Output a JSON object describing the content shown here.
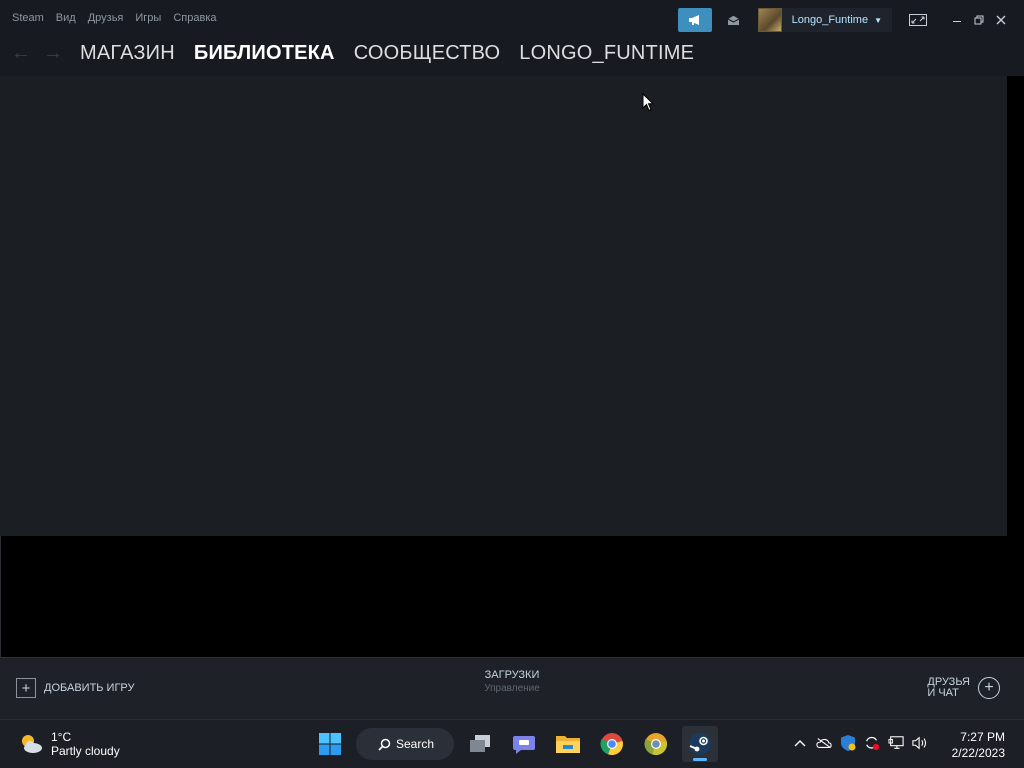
{
  "menu": {
    "items": [
      "Steam",
      "Вид",
      "Друзья",
      "Игры",
      "Справка"
    ]
  },
  "account": {
    "username": "Longo_Funtime"
  },
  "nav": {
    "items": [
      "МАГАЗИН",
      "БИБЛИОТЕКА",
      "СООБЩЕСТВО",
      "LONGO_FUNTIME"
    ],
    "active": "БИБЛИОТЕКА"
  },
  "bottom": {
    "add_game": "ДОБАВИТЬ ИГРУ",
    "downloads_title": "ЗАГРУЗКИ",
    "downloads_sub": "Управление",
    "friends_line1": "ДРУЗЬЯ",
    "friends_line2": "И ЧАТ"
  },
  "taskbar": {
    "weather_temp": "1°C",
    "weather_desc": "Partly cloudy",
    "search_label": "Search",
    "time": "7:27 PM",
    "date": "2/22/2023"
  },
  "colors": {
    "window_bg": "#171a21",
    "content_bg": "#1b1e22",
    "accent": "#3d8fbd",
    "username": "#b7e6ff"
  }
}
